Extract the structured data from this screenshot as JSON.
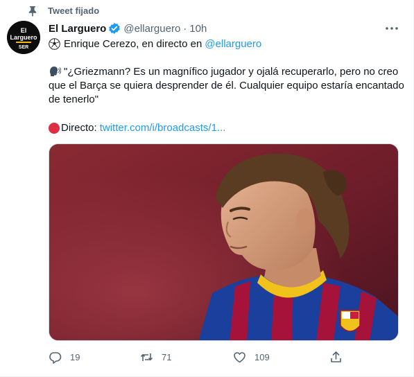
{
  "pinned": {
    "label": "Tweet fijado",
    "icon": "pin-icon"
  },
  "author": {
    "display_name": "El Larguero",
    "handle": "@ellarguero",
    "separator": "·",
    "time": "10h",
    "verified": true,
    "avatar_text": {
      "line1": "El",
      "line2": "Larguero",
      "brand": "SER"
    }
  },
  "tweet": {
    "line1_text": "Enrique Cerezo, en directo en",
    "line1_mention": "@ellarguero",
    "quote": "\"¿Griezmann? Es un magnífico jugador y ojalá recuperarlo, pero no creo que el Barça se quiera desprender de él. Cualquier equipo estaría encantado de tenerlo\"",
    "live_label": "Directo:",
    "live_link": "twitter.com/i/broadcasts/1..."
  },
  "actions": {
    "reply_count": "19",
    "retweet_count": "71",
    "like_count": "109"
  },
  "colors": {
    "accent": "#1d9bf0",
    "secondary_text": "#536471",
    "live_red": "#dd2e44"
  }
}
